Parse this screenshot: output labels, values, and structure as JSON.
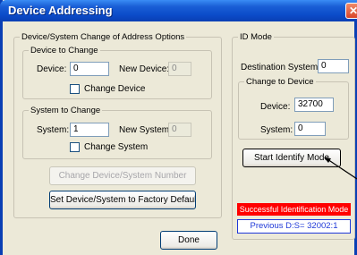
{
  "window": {
    "title": "Device Addressing",
    "close_glyph": "✕"
  },
  "change_options": {
    "legend": "Device/System Change of Address Options",
    "device_group": {
      "legend": "Device to Change",
      "device_label": "Device:",
      "device_value": "0",
      "new_device_label": "New Device:",
      "new_device_value": "0",
      "change_device_label": "Change Device",
      "change_device_checked": false
    },
    "system_group": {
      "legend": "System to Change",
      "system_label": "System:",
      "system_value": "1",
      "new_system_label": "New System:",
      "new_system_value": "0",
      "change_system_label": "Change System",
      "change_system_checked": false
    },
    "change_number_button": "Change Device/System Number",
    "factory_default_button": "Set Device/System to Factory Default"
  },
  "id_mode": {
    "legend": "ID Mode",
    "destination_label": "Destination System:",
    "destination_value": "0",
    "change_to_device": {
      "legend": "Change to Device",
      "device_label": "Device:",
      "device_value": "32700",
      "system_label": "System:",
      "system_value": "0"
    },
    "start_identify_button": "Start Identify Mode",
    "status_message": "Successful Identification Mode",
    "previous_label": "Previous D:S= 32002:1"
  },
  "footer": {
    "done_button": "Done"
  },
  "colors": {
    "titlebar": "#0a3fb4",
    "status_bg": "#ff0000",
    "previous_text": "#1f38d8",
    "dialog_bg": "#ece9d8"
  }
}
